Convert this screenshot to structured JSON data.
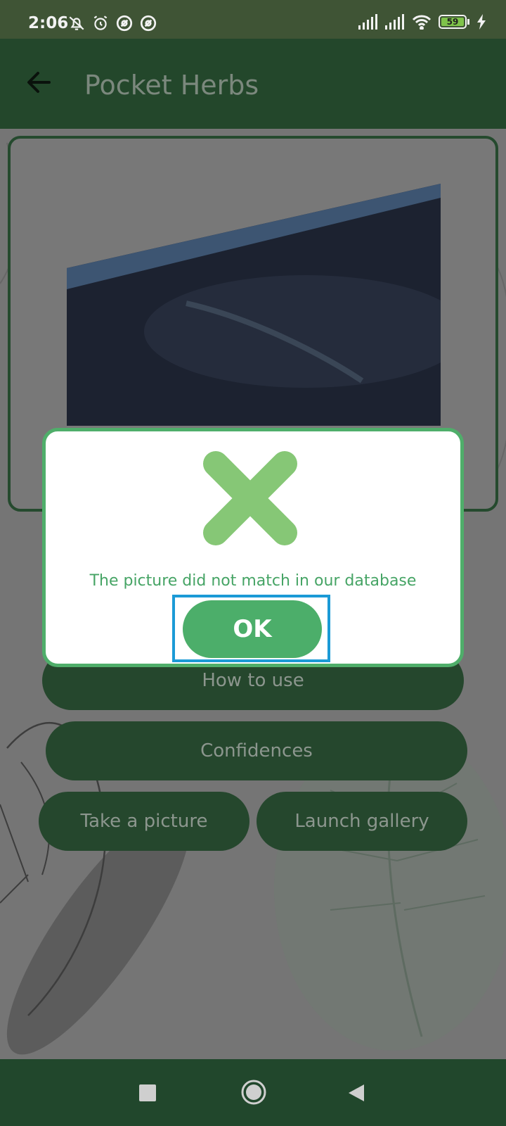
{
  "status_bar": {
    "time": "2:06",
    "battery_level": "59",
    "icons": [
      "notifications-off-icon",
      "alarm-icon",
      "app-icon",
      "app-icon",
      "cell-signal-icon",
      "cell-signal-icon",
      "wifi-icon",
      "battery-icon",
      "charging-icon"
    ]
  },
  "app_bar": {
    "title": "Pocket Herbs",
    "back_icon": "arrow-left-icon"
  },
  "buttons": {
    "how_to_use": "How to use",
    "confidences": "Confidences",
    "take_picture": "Take a picture",
    "launch_gallery": "Launch gallery"
  },
  "dialog": {
    "icon": "close-x-icon",
    "message": "The picture did not match in our database",
    "ok_label": "OK"
  },
  "nav_bar": {
    "icons": [
      "recents-square-icon",
      "home-circle-icon",
      "back-triangle-icon"
    ]
  },
  "colors": {
    "app_bar": "#23472b",
    "button": "#25472d",
    "accent": "#4cae6a",
    "x_icon": "#86c776",
    "focus_outline": "#1b9ad6"
  }
}
